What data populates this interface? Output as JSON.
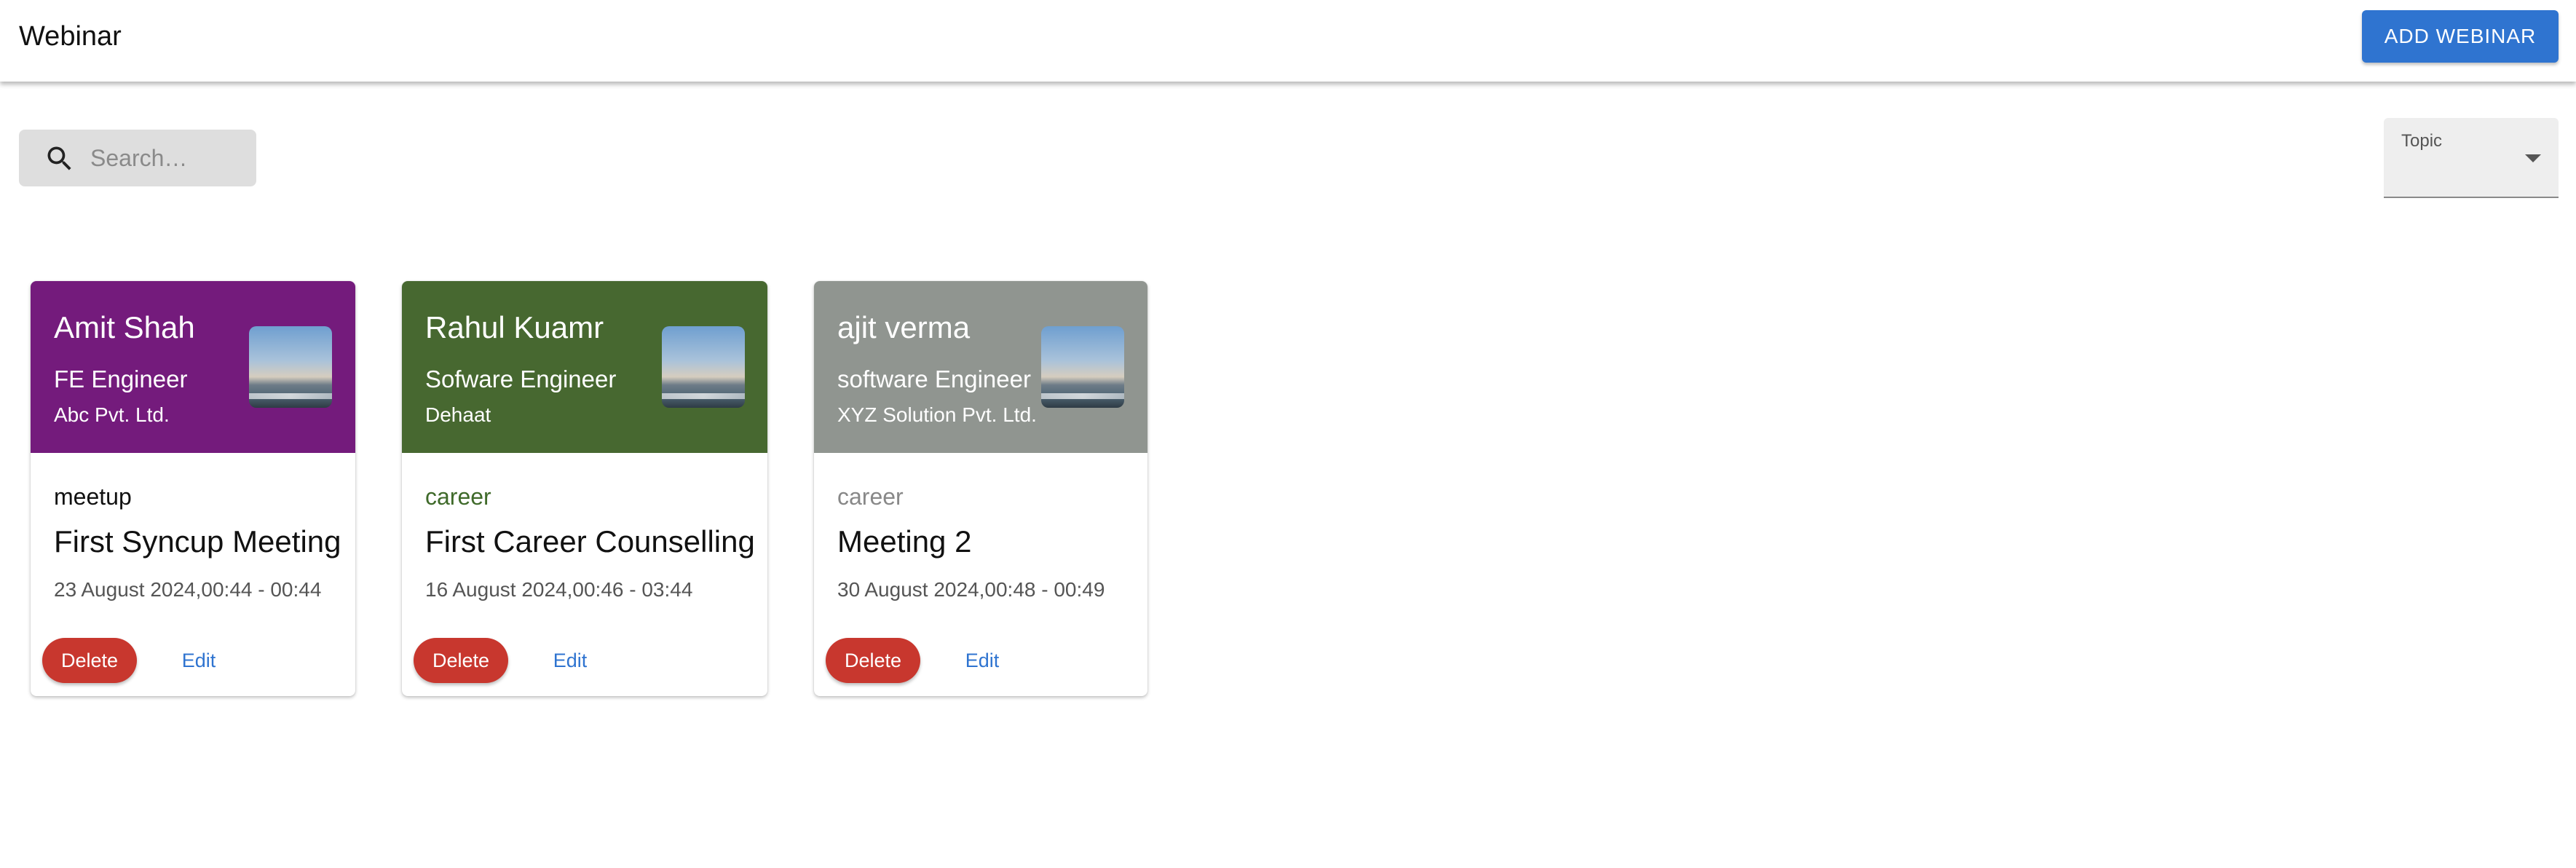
{
  "appbar": {
    "title": "Webinar",
    "add_button_label": "ADD WEBINAR"
  },
  "filters": {
    "search_placeholder": "Search…",
    "topic_label": "Topic",
    "topic_value": ""
  },
  "colors": {
    "primary": "#2f74d0",
    "danger": "#c8372e"
  },
  "cards": [
    {
      "name": "Amit Shah",
      "role": "FE Engineer",
      "company": "Abc Pvt. Ltd.",
      "topic": "meetup",
      "title": "First Syncup Meeting",
      "date": "23 August 2024,00:44 - 00:44",
      "header_color": "#741b7c",
      "topic_color": "#111111",
      "delete_label": "Delete",
      "edit_label": "Edit"
    },
    {
      "name": "Rahul Kuamr",
      "role": "Sofware Engineer",
      "company": "Dehaat",
      "topic": "career",
      "title": "First Career Counselling",
      "date": "16 August 2024,00:46 - 03:44",
      "header_color": "#476830",
      "topic_color": "#3f6a2a",
      "delete_label": "Delete",
      "edit_label": "Edit"
    },
    {
      "name": "ajit verma",
      "role": "software Engineer",
      "company": "XYZ Solution Pvt. Ltd.",
      "topic": "career",
      "title": "Meeting 2",
      "date": "30 August 2024,00:48 - 00:49",
      "header_color": "#909590",
      "topic_color": "#888888",
      "delete_label": "Delete",
      "edit_label": "Edit"
    }
  ]
}
